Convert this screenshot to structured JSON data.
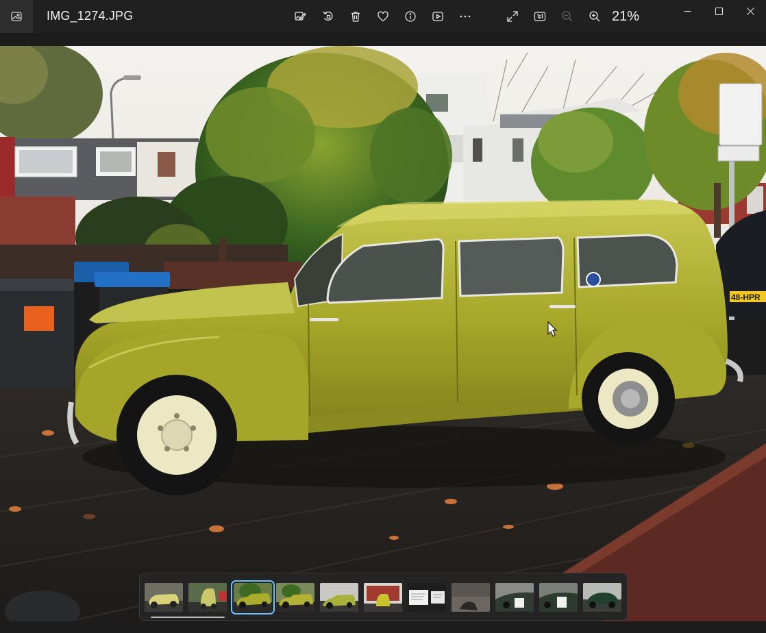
{
  "window": {
    "title": "IMG_1274.JPG",
    "app_icon": "photo-app-icon",
    "controls": [
      "minimize-icon",
      "maximize-icon",
      "close-icon"
    ]
  },
  "toolbar": {
    "tools": [
      "edit-image-icon",
      "rotate-icon",
      "delete-icon",
      "favorite-icon",
      "info-icon",
      "slideshow-icon",
      "more-options-icon"
    ],
    "view_tools": [
      "full-screen-icon",
      "actual-size-icon",
      "zoom-out-icon",
      "zoom-in-icon"
    ],
    "zoom_level": "21%"
  },
  "photo": {
    "plate_text": "48-HPR"
  },
  "filmstrip": {
    "thumbnails": [
      {
        "id": "thumb-1",
        "selected": false
      },
      {
        "id": "thumb-2",
        "selected": false
      },
      {
        "id": "thumb-3",
        "selected": true
      },
      {
        "id": "thumb-4",
        "selected": false
      },
      {
        "id": "thumb-5",
        "selected": false
      },
      {
        "id": "thumb-6",
        "selected": false
      },
      {
        "id": "thumb-7",
        "selected": false
      },
      {
        "id": "thumb-8",
        "selected": false
      },
      {
        "id": "thumb-9",
        "selected": false
      },
      {
        "id": "thumb-10",
        "selected": false
      },
      {
        "id": "thumb-11",
        "selected": false
      }
    ]
  },
  "colors": {
    "accent": "#6cc4ff",
    "titlebar": "#202020",
    "car_body": "#a8a82a"
  }
}
